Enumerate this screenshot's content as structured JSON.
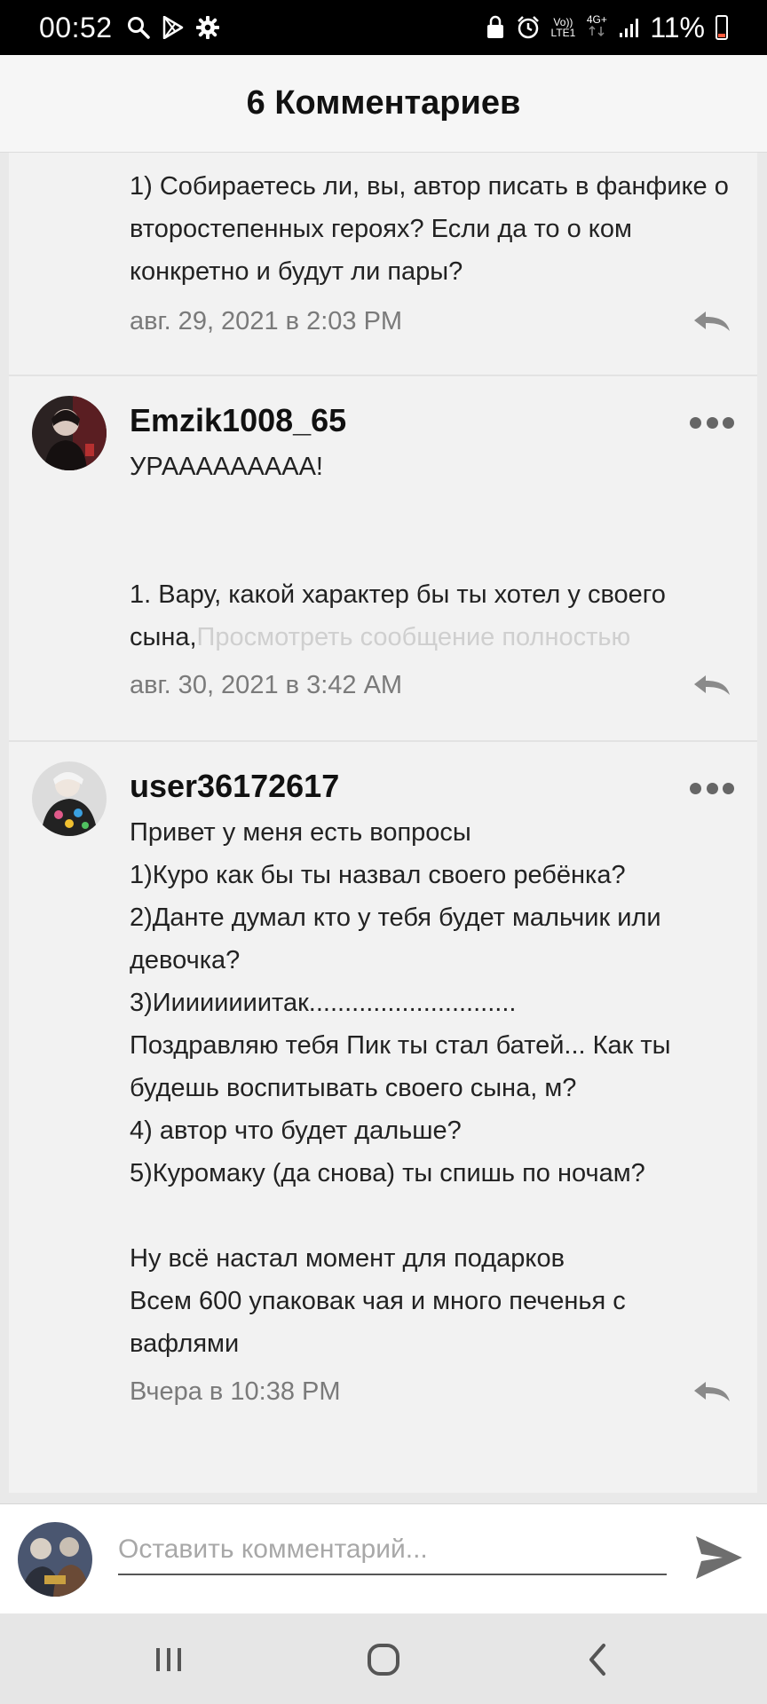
{
  "status_bar": {
    "time": "00:52",
    "network_top": "Vo))",
    "network_bottom": "LTE1",
    "signal_label": "4G+",
    "battery_percent": "11%",
    "left_icons": [
      "search-icon",
      "play-store-icon",
      "settings-gear-icon"
    ],
    "right_icons": [
      "lock-icon",
      "alarm-icon",
      "signal-icon",
      "battery-icon"
    ]
  },
  "header": {
    "title": "6 Комментариев"
  },
  "comments": [
    {
      "partial": true,
      "text": "1) Собираетесь ли, вы, автор писать в фанфике о второстепенных героях? Если да то о ком конкретно и будут ли пары?",
      "timestamp": "авг. 29, 2021 в 2:03 PM"
    },
    {
      "username": "Emzik1008_65",
      "text": "УРААААААААА!\n\n\n1. Вару, какой характер бы ты хотел у своего сына,",
      "view_full": "Просмотреть сообщение полностью",
      "timestamp": "авг. 30, 2021 в 3:42 AM"
    },
    {
      "username": "user36172617",
      "text": "Привет у меня есть вопросы\n1)Куро как бы ты назвал своего ребёнка?\n2)Данте думал кто у тебя будет мальчик или девочка?\n3)Иииииииитак.............................\nПоздравляю тебя Пик ты стал батей... Как ты будешь воспитывать своего сына, м?\n4) автор что будет дальше?\n5)Куромаку (да снова) ты спишь по ночам?\n\nНу всё настал момент для подарков\nВсем 600 упаковак чая и много печенья с вафлями",
      "timestamp": "Вчера в 10:38 PM"
    }
  ],
  "composer": {
    "placeholder": "Оставить комментарий..."
  },
  "colors": {
    "accent_dark": "#111111",
    "timestamp_gray": "#7a7a7a",
    "view_full_gray": "#cfcfcf",
    "battery_low": "#ff5a3c"
  }
}
